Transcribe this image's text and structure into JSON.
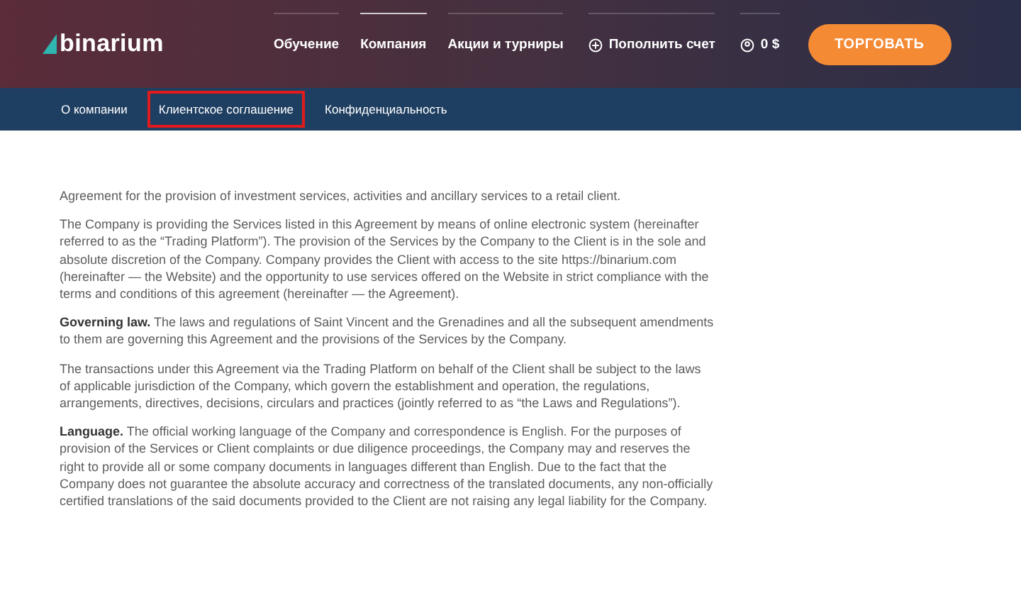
{
  "header": {
    "logo": "binarium",
    "nav": [
      {
        "label": "Обучение",
        "selected": false
      },
      {
        "label": "Компания",
        "selected": true
      },
      {
        "label": "Акции и турниры",
        "selected": false
      }
    ],
    "deposit": "Пополнить счет",
    "balance": "0 $",
    "trade_button": "ТОРГОВАТЬ"
  },
  "subnav": [
    {
      "label": "О компании",
      "selected": false
    },
    {
      "label": "Клиентское соглашение",
      "selected": true
    },
    {
      "label": "Конфиденциальность",
      "selected": false
    }
  ],
  "paragraphs": [
    "Agreement for the provision of investment services, activities and ancillary services to a retail client.",
    "The Company is providing the Services listed in this Agreement by means of online electronic system (hereinafter referred to as the “Trading Platform”). The provision of the Services by the Company to the Client is in the sole and absolute discretion of the Company. Company provides the Client with access to the site https://binarium.com (hereinafter — the Website) and the opportunity to use services offered on the Website in strict compliance with the terms and conditions of this agreement (hereinafter — the Agreement).",
    "**Governing law.** The laws and regulations of Saint Vincent and the Grenadines and all the subsequent amendments to them are governing this Agreement and the provisions of the Services by the Company.",
    "The transactions under this Agreement via the Trading Platform on behalf of the Client shall be subject to the laws of applicable jurisdiction of the Company, which govern the establishment and operation, the regulations, arrangements, directives, decisions, circulars and practices (jointly referred to as “the Laws and Regulations”).",
    "**Language.** The official working language of the Company and correspondence is English. For the purposes of provision of the Services or Client complaints or due diligence proceedings, the Company may and reserves the right to provide all or some company documents in languages different than English. Due to the fact that the Company does not guarantee the absolute accuracy and correctness of the translated documents, any non-officially certified translations of the said documents provided to the Client are not raising any legal liability for the Company."
  ]
}
